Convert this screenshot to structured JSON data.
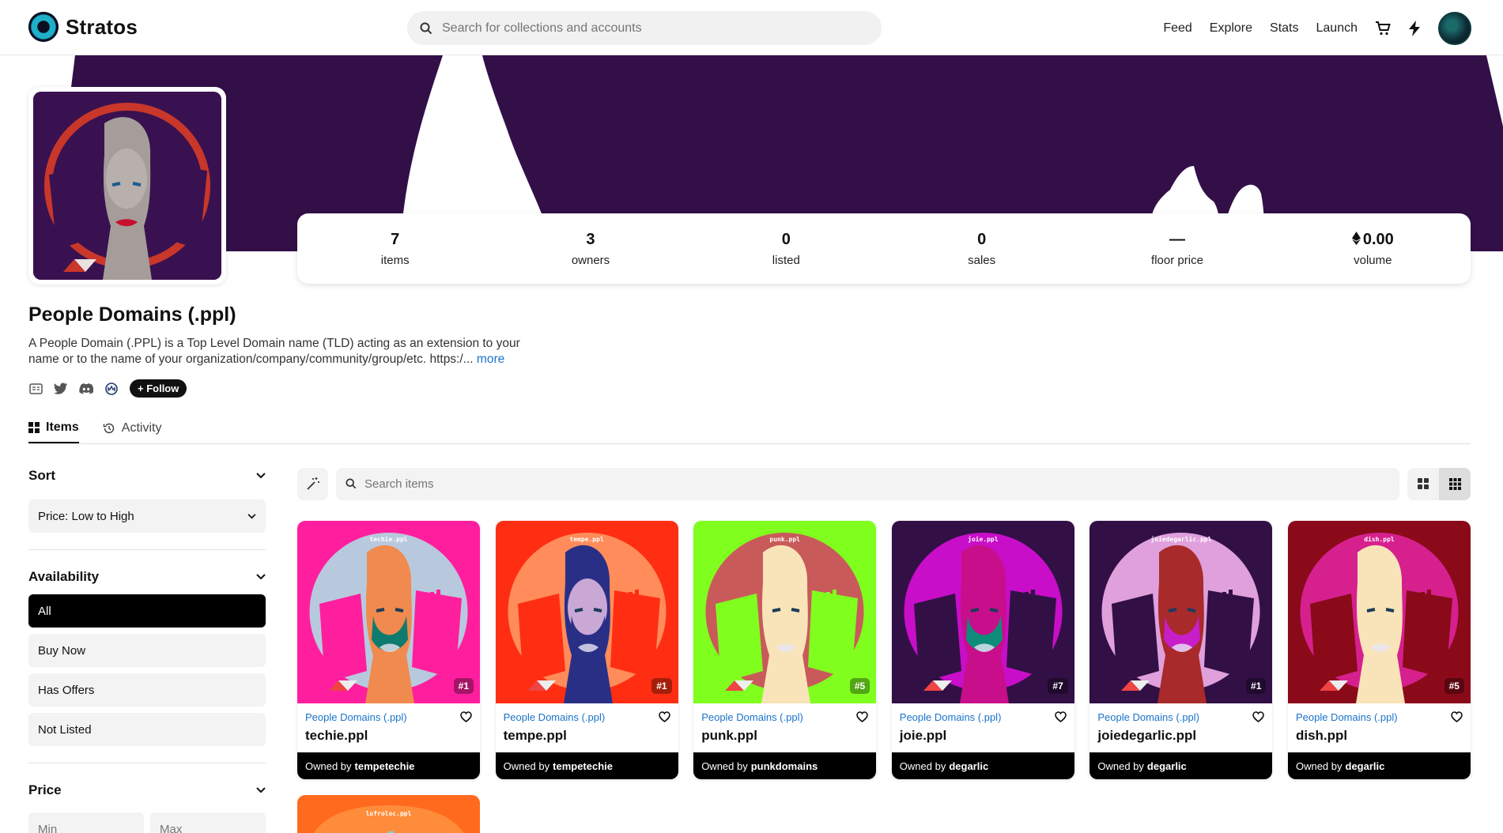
{
  "header": {
    "brand": "Stratos",
    "search_placeholder": "Search for collections and accounts",
    "nav": [
      "Feed",
      "Explore",
      "Stats",
      "Launch"
    ]
  },
  "collection": {
    "title": "People Domains (.ppl)",
    "description": "A People Domain (.PPL) is a Top Level Domain name (TLD) acting as an extension to your name or to the name of your organization/company/community/group/etc. https:/...",
    "more": "more",
    "follow": "+ Follow",
    "stats": [
      {
        "value": "7",
        "label": "items"
      },
      {
        "value": "3",
        "label": "owners"
      },
      {
        "value": "0",
        "label": "listed"
      },
      {
        "value": "0",
        "label": "sales"
      },
      {
        "value": "—",
        "label": "floor price"
      },
      {
        "value": "0.00",
        "label": "volume"
      }
    ]
  },
  "tabs": [
    {
      "label": "Items",
      "active": true
    },
    {
      "label": "Activity",
      "active": false
    }
  ],
  "sidebar": {
    "sort_title": "Sort",
    "sort_value": "Price: Low to High",
    "availability_title": "Availability",
    "availability_options": [
      "All",
      "Buy Now",
      "Has Offers",
      "Not Listed"
    ],
    "price_title": "Price",
    "min_placeholder": "Min",
    "max_placeholder": "Max"
  },
  "items_search_placeholder": "Search items",
  "owned_by_prefix": "Owned by",
  "items": [
    {
      "label": "techie.ppl",
      "collection": "People Domains (.ppl)",
      "name": "techie.ppl",
      "owner": "tempetechie",
      "num": "#1",
      "bg": "#ff1f9e",
      "circle": "#b8c9de",
      "face": "#f08a4e",
      "hair": "#f08a4e",
      "mask": "#0f7a6e"
    },
    {
      "label": "tempe.ppl",
      "collection": "People Domains (.ppl)",
      "name": "tempe.ppl",
      "owner": "tempetechie",
      "num": "#1",
      "bg": "#ff2e12",
      "circle": "#ff8c5a",
      "face": "#c9a8d6",
      "hair": "#2a2f86",
      "mask": "#2a2f86"
    },
    {
      "label": "punk.ppl",
      "collection": "People Domains (.ppl)",
      "name": "punk.ppl",
      "owner": "punkdomains",
      "num": "#5",
      "bg": "#80ff1f",
      "circle": "#c95a5a",
      "face": "#f8e4b8",
      "hair": "#f8e4b8",
      "mask": "#f8e4b8"
    },
    {
      "label": "joie.ppl",
      "collection": "People Domains (.ppl)",
      "name": "joie.ppl",
      "owner": "degarlic",
      "num": "#7",
      "bg": "#321046",
      "circle": "#c80ec8",
      "face": "#c80e8a",
      "hair": "#c80e8a",
      "mask": "#0e8c7a"
    },
    {
      "label": "joiedegarlic.ppl",
      "collection": "People Domains (.ppl)",
      "name": "joiedegarlic.ppl",
      "owner": "degarlic",
      "num": "#1",
      "bg": "#321046",
      "circle": "#dfa0dc",
      "face": "#a82a2a",
      "hair": "#a82a2a",
      "mask": "#c81ec8"
    },
    {
      "label": "dish.ppl",
      "collection": "People Domains (.ppl)",
      "name": "dish.ppl",
      "owner": "degarlic",
      "num": "#5",
      "bg": "#8a0a1a",
      "circle": "#d6208e",
      "face": "#f8e4b8",
      "hair": "#f8e4b8",
      "mask": "#f8e4b8"
    }
  ],
  "partial_item": {
    "label": "lufroloc.ppl",
    "bg": "#ff6a1f",
    "circle": "#ff8c3a"
  }
}
